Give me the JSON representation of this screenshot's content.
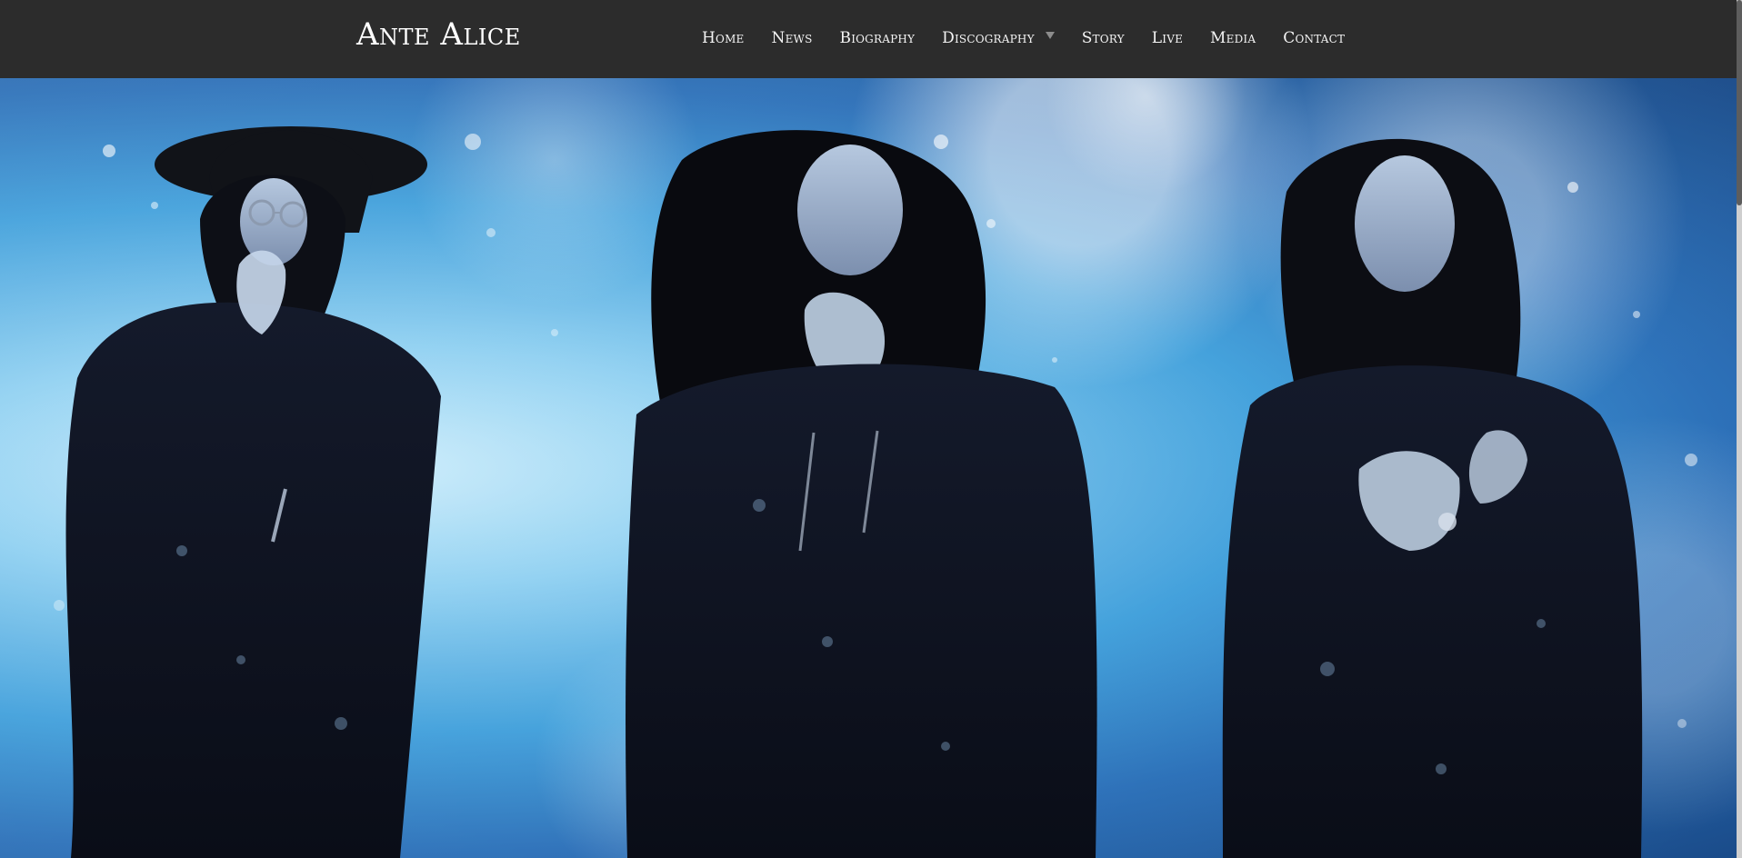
{
  "header": {
    "logo_text": "Ante Alice",
    "nav": [
      {
        "label": "Home"
      },
      {
        "label": "News"
      },
      {
        "label": "Biography"
      },
      {
        "label": "Discography",
        "has_dropdown": true
      },
      {
        "label": "Story"
      },
      {
        "label": "Live"
      },
      {
        "label": "Media"
      },
      {
        "label": "Contact"
      }
    ]
  },
  "hero": {
    "image": "band-photo"
  },
  "colors": {
    "header_bg": "#2c2c2c",
    "text": "#ffffff",
    "caret": "#8c8c8c",
    "hero_light_blue": "#8fd0f1",
    "hero_deep_blue": "#1a4b89"
  },
  "icons": {
    "dropdown": "chevron-down-icon"
  }
}
